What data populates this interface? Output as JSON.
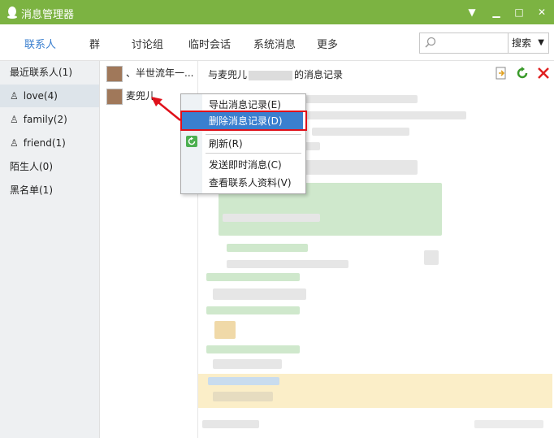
{
  "titlebar": {
    "title": "消息管理器"
  },
  "nav": {
    "tabs": [
      "联系人",
      "群",
      "讨论组",
      "临时会话",
      "系统消息",
      "更多"
    ],
    "search": {
      "placeholder": "",
      "button_label": "搜索"
    }
  },
  "sidebar": {
    "items": [
      {
        "label": "最近联系人(1)"
      },
      {
        "label": "love(4)"
      },
      {
        "label": "family(2)"
      },
      {
        "label": "friend(1)"
      },
      {
        "label": "陌生人(0)"
      },
      {
        "label": "黑名单(1)"
      }
    ]
  },
  "contacts": [
    {
      "name": "、半世流年一..."
    },
    {
      "name": "麦兜儿"
    }
  ],
  "record": {
    "title_prefix": "与麦兜儿",
    "title_suffix": "的消息记录"
  },
  "context_menu": {
    "items": [
      {
        "label": "导出消息记录(E)"
      },
      {
        "label": "删除消息记录(D)"
      },
      {
        "label": "刷新(R)"
      },
      {
        "label": "发送即时消息(C)"
      },
      {
        "label": "查看联系人资料(V)"
      }
    ]
  },
  "colors": {
    "titlebar": "#7cb342",
    "accent": "#3a7fcf",
    "highlight_red": "#e0101a"
  }
}
